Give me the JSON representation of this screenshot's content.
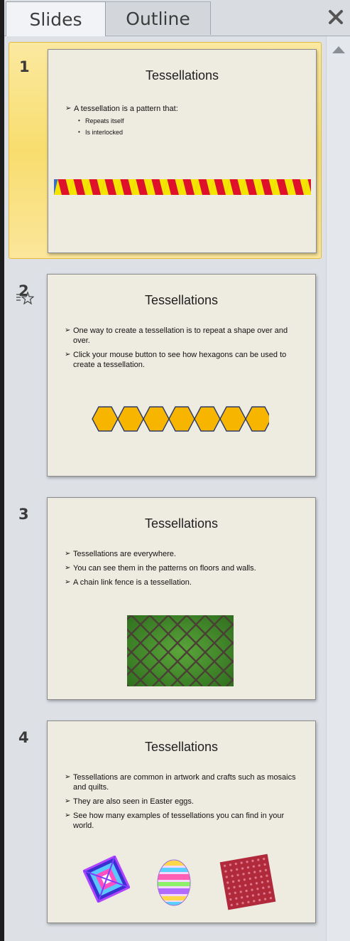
{
  "tabs": {
    "slides": "Slides",
    "outline": "Outline"
  },
  "slides": [
    {
      "number": "1",
      "title": "Tessellations",
      "bullet1": "A tessellation is a pattern that:",
      "sub1": "Repeats itself",
      "sub2": "Is interlocked"
    },
    {
      "number": "2",
      "title": "Tessellations",
      "bullet1": "One way to create a tessellation is to repeat a shape over and over.",
      "bullet2": "Click your mouse button to see how hexagons can be used to create a tessellation."
    },
    {
      "number": "3",
      "title": "Tessellations",
      "bullet1": "Tessellations are everywhere.",
      "bullet2": "You can see them in the patterns on floors and walls.",
      "bullet3": "A chain link fence is a tessellation."
    },
    {
      "number": "4",
      "title": "Tessellations",
      "bullet1": "Tessellations are common in artwork and crafts such as mosaics and quilts.",
      "bullet2": "They are also seen in Easter eggs.",
      "bullet3": "See how many examples of tessellations you can find in your world."
    }
  ],
  "colors": {
    "selection": "#f8dd6e",
    "slide_bg": "#eeebe1",
    "hexagon": "#f7b500",
    "triangle_red": "#e0102a",
    "triangle_yellow": "#f5e400",
    "triangle_blue": "#3b6fc4"
  },
  "icons": {
    "close": "close-icon",
    "animation": "animation-star-icon",
    "scroll": "scroll-up-arrow-icon"
  }
}
